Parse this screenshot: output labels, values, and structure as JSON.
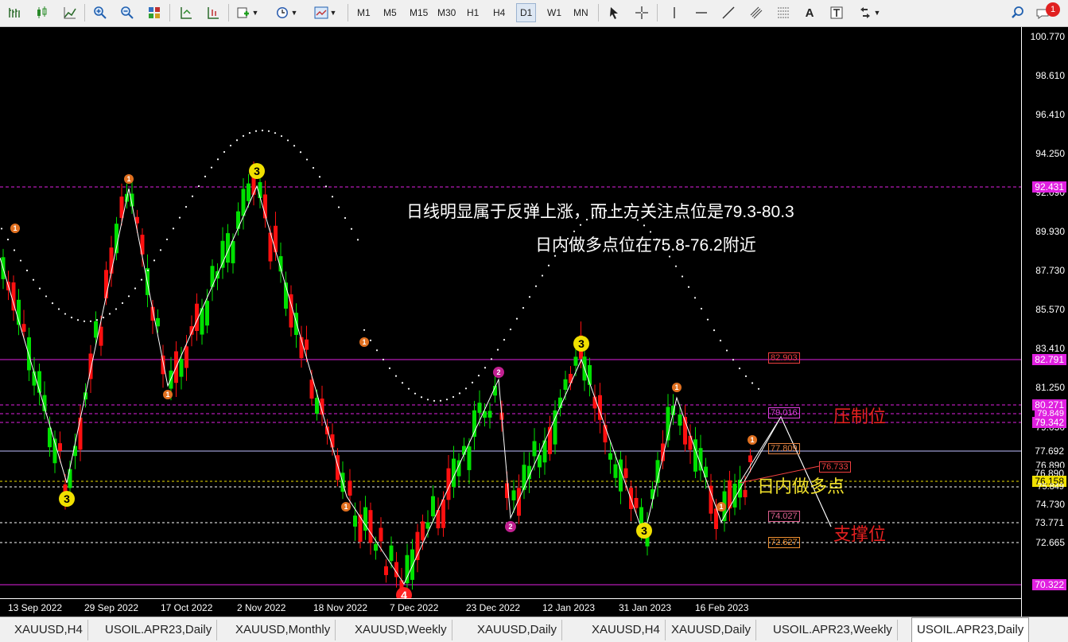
{
  "toolbar": {
    "timeframes": [
      "M1",
      "M5",
      "M15",
      "M30",
      "H1",
      "H4",
      "D1",
      "W1",
      "MN"
    ],
    "active_timeframe": "D1",
    "notification_count": "1"
  },
  "chart": {
    "annotation_line1": "日线明显属于反弹上涨，而上方关注点位是79.3-80.3",
    "annotation_line2": "日内做多点位在75.8-76.2附近",
    "label_resistance": "压制位",
    "label_long": "日内做多点",
    "label_support": "支撑位",
    "price_ticks": [
      "100.770",
      "98.610",
      "96.410",
      "94.250",
      "92.090",
      "89.930",
      "87.730",
      "85.570",
      "83.410",
      "81.250",
      "79.050",
      "76.890",
      "74.730",
      "72.665"
    ],
    "price_markers": {
      "p92431": "92.431",
      "p82791": "82.791",
      "p82903": "82.903",
      "p80271": "80.271",
      "p79849": "79.849",
      "p79342": "79.342",
      "p79016": "79.016",
      "p77809": "77.809",
      "p77692": "77.692",
      "p76733": "76.733",
      "p76158": "76.158",
      "p75849": "75.849",
      "p74027": "74.027",
      "p73771": "73.771",
      "p72627": "72.627",
      "p70322": "70.322"
    },
    "wave_labels": {
      "w1": "1",
      "w2": "2",
      "w3": "3",
      "w4": "4"
    },
    "time_ticks": [
      "13 Sep 2022",
      "29 Sep 2022",
      "17 Oct 2022",
      "2 Nov 2022",
      "18 Nov 2022",
      "7 Dec 2022",
      "23 Dec 2022",
      "12 Jan 2023",
      "31 Jan 2023",
      "16 Feb 2023"
    ],
    "colors": {
      "up": "#00e000",
      "down": "#ff1010",
      "magenta": "#e020e0",
      "zigzag": "#ffffff"
    }
  },
  "tabs": [
    "XAUUSD,H4",
    "USOIL.APR23,Daily",
    "XAUUSD,Monthly",
    "XAUUSD,Weekly",
    "XAUUSD,Daily",
    "XAUUSD,H4",
    "XAUUSD,Daily",
    "USOIL.APR23,Weekly",
    "USOIL.APR23,Daily"
  ],
  "active_tab": "USOIL.APR23,Daily"
}
